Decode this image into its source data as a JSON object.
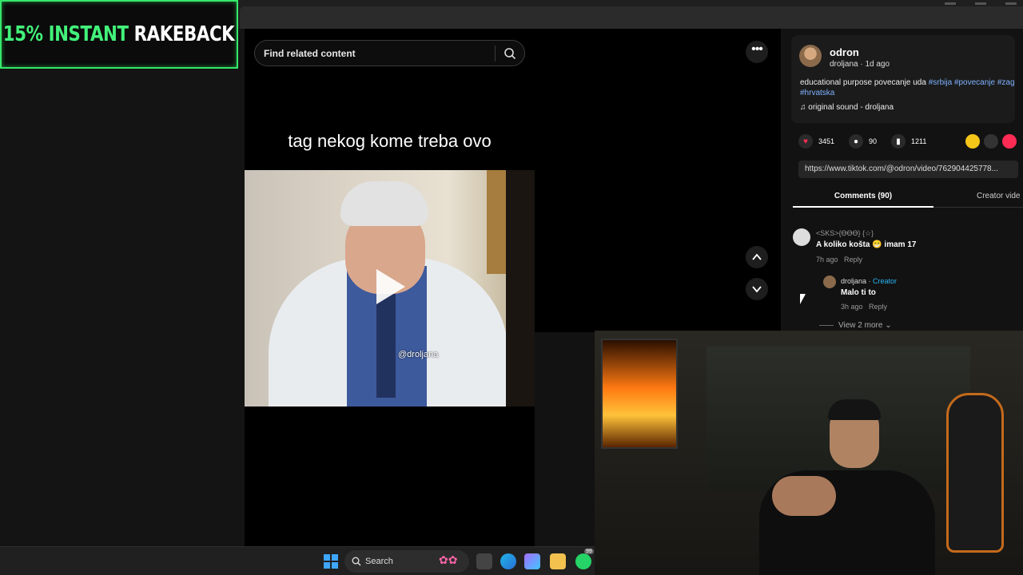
{
  "banner": {
    "part1": "15% INSTANT ",
    "part2": "RAKEBACK"
  },
  "search": {
    "placeholder": "Find related content",
    "icon": "search-icon"
  },
  "video": {
    "caption": "tag nekog kome treba ovo",
    "watermark": "@droljana",
    "play_icon": "play-icon"
  },
  "author": {
    "name": "odron",
    "handle_time": "droljana · 1d ago",
    "description": "educational purpose povecanje uda",
    "hashtags": [
      "#srbija",
      "#povecanje",
      "#zag",
      "#hrvatska"
    ],
    "sound": "original sound - droljana"
  },
  "stats": {
    "likes": "3451",
    "comments": "90",
    "saves": "1211"
  },
  "share_icons": [
    "share-yellow-icon",
    "embed-icon",
    "send-icon"
  ],
  "url": "https://www.tiktok.com/@odron/video/762904425778...",
  "tabs": {
    "comments": "Comments (90)",
    "creator": "Creator vide"
  },
  "comments": [
    {
      "user": "<SKS>{ϴϴϴ} {☆}",
      "text": "A koliko košta 😁 imam 17",
      "time": "7h ago",
      "reply": "Reply"
    }
  ],
  "reply": {
    "user": "droljana",
    "badge": "Creator",
    "text": "Malo ti to",
    "time": "3h ago",
    "reply": "Reply"
  },
  "view_more": "View 2 more",
  "taskbar": {
    "search_label": "Search",
    "badge": "99"
  },
  "colors": {
    "banner_accent": "#42f27a",
    "tiktok_red": "#fe2c55",
    "creator_blue": "#29b6f6",
    "hashtag_blue": "#7fb2ff"
  }
}
